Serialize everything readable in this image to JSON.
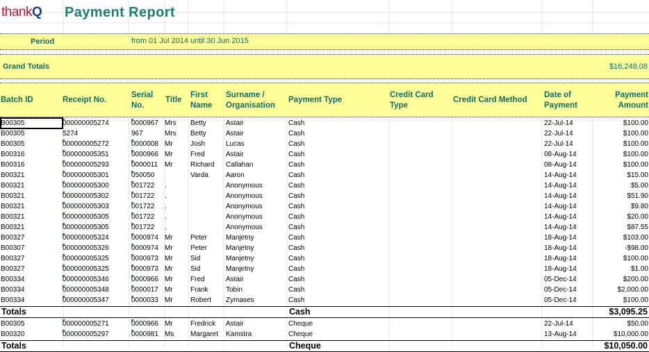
{
  "header": {
    "logo_main": "thank",
    "logo_q": "Q",
    "title": "Payment Report"
  },
  "period": {
    "label": "Period",
    "value": "from 01 Jul 2014 until 30 Jun 2015"
  },
  "grand_totals": {
    "label": "Grand Totals",
    "value": "$16,248.08"
  },
  "columns": [
    {
      "key": "batch",
      "label": "Batch ID"
    },
    {
      "key": "receipt",
      "label": "Receipt No."
    },
    {
      "key": "serial",
      "label": "Serial No."
    },
    {
      "key": "title",
      "label": "Title"
    },
    {
      "key": "first",
      "label": "First Name"
    },
    {
      "key": "surname",
      "label": "Surname / Organisation"
    },
    {
      "key": "ptype",
      "label": "Payment Type"
    },
    {
      "key": "cctype",
      "label": "Credit Card Type"
    },
    {
      "key": "ccmethod",
      "label": "Credit Card Method"
    },
    {
      "key": "date",
      "label": "Date of Payment"
    },
    {
      "key": "amount",
      "label": "Payment Amount"
    }
  ],
  "groups": [
    {
      "rows": [
        [
          "B00305",
          "000000005274",
          "0000967",
          "Mrs",
          "Betty",
          "Astair",
          "Cash",
          "",
          "",
          "22-Jul-14",
          "$100.00"
        ],
        [
          "B00305",
          "5274",
          "967",
          "Mrs",
          "Betty",
          "Astair",
          "Cash",
          "",
          "",
          "22-Jul-14",
          "$100.00"
        ],
        [
          "B00305",
          "000000005272",
          "0000008",
          "Mr",
          "Josh",
          "Lucas",
          "Cash",
          "",
          "",
          "22-Jul-14",
          "$100.00"
        ],
        [
          "B00316",
          "000000005351",
          "0000966",
          "Mr",
          "Fred",
          "Astair",
          "Cash",
          "",
          "",
          "08-Aug-14",
          "$100.00"
        ],
        [
          "B00316",
          "000000005293",
          "0000011",
          "Mr",
          "Richard",
          "Callahan",
          "Cash",
          "",
          "",
          "08-Aug-14",
          "$100.00"
        ],
        [
          "B00321",
          "000000005301",
          "050050",
          "",
          "Varda",
          "Aaron",
          "Cash",
          "",
          "",
          "14-Aug-14",
          "$15.00"
        ],
        [
          "B00321",
          "000000005300",
          "001722",
          ".",
          "",
          "Anonymous",
          "Cash",
          "",
          "",
          "14-Aug-14",
          "$5.00"
        ],
        [
          "B00321",
          "000000005302",
          "001722",
          ".",
          "",
          "Anonymous",
          "Cash",
          "",
          "",
          "14-Aug-14",
          "$51.90"
        ],
        [
          "B00321",
          "000000005303",
          "001722",
          ".",
          "",
          "Anonymous",
          "Cash",
          "",
          "",
          "14-Aug-14",
          "$9.80"
        ],
        [
          "B00321",
          "000000005305",
          "001722",
          ".",
          "",
          "Anonymous",
          "Cash",
          "",
          "",
          "14-Aug-14",
          "$20.00"
        ],
        [
          "B00321",
          "000000005305",
          "001722",
          ".",
          "",
          "Anonymous",
          "Cash",
          "",
          "",
          "14-Aug-14",
          "$87.55"
        ],
        [
          "B00327",
          "000000005324",
          "0000974",
          "Mr",
          "Peter",
          "Manjetny",
          "Cash",
          "",
          "",
          "18-Aug-14",
          "$103.00"
        ],
        [
          "B00307",
          "000000005326",
          "0000974",
          "Mr",
          "Peter",
          "Manjetny",
          "Cash",
          "",
          "",
          "18-Aug-14",
          "-$98.00"
        ],
        [
          "B00327",
          "000000005325",
          "0000973",
          "Mr",
          "Sid",
          "Manjetny",
          "Cash",
          "",
          "",
          "18-Aug-14",
          "$100.00"
        ],
        [
          "B00327",
          "000000005325",
          "0000973",
          "Mr",
          "Sid",
          "Manjetny",
          "Cash",
          "",
          "",
          "18-Aug-14",
          "$1.00"
        ],
        [
          "B00334",
          "000000005346",
          "0000966",
          "Mr",
          "Fred",
          "Astair",
          "Cash",
          "",
          "",
          "05-Dec-14",
          "$200.00"
        ],
        [
          "B00334",
          "000000005348",
          "0000017",
          "Mr",
          "Frank",
          "Tobin",
          "Cash",
          "",
          "",
          "05-Dec-14",
          "$2,000.00"
        ],
        [
          "B00334",
          "000000005347",
          "0000033",
          "Mr",
          "Robert",
          "Zymases",
          "Cash",
          "",
          "",
          "05-Dec-14",
          "$100.00"
        ]
      ],
      "totals": {
        "label": "Totals",
        "type": "Cash",
        "amount": "$3,095.25"
      }
    },
    {
      "rows": [
        [
          "B00305",
          "000000005271",
          "0000966",
          "Mr",
          "Fredrick",
          "Astair",
          "Cheque",
          "",
          "",
          "22-Jul-14",
          "$50.00"
        ],
        [
          "B00320",
          "000000005297",
          "0000981",
          "Ms",
          "Margaret",
          "Kamstra",
          "Cheque",
          "",
          "",
          "13-Aug-14",
          "$10,000.00"
        ]
      ],
      "totals": {
        "label": "Totals",
        "type": "Cheque",
        "amount": "$10,050.00"
      }
    }
  ],
  "colors": {
    "band": "#ffff99",
    "header_text": "#0b6f69",
    "title": "#1a7f74",
    "logo_red": "#c8102e",
    "logo_blue": "#1a3f8f",
    "marker": "#1a8f2a"
  }
}
